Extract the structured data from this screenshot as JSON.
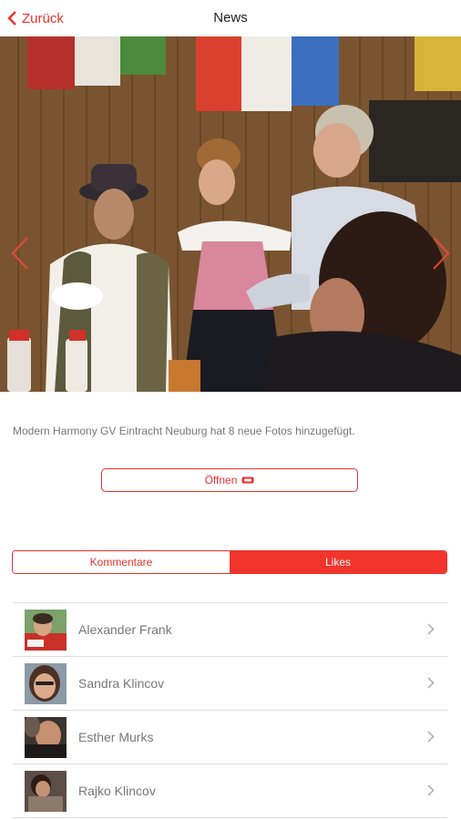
{
  "nav": {
    "back_label": "Zurück",
    "title": "News"
  },
  "post": {
    "caption": "Modern Harmony GV Eintracht Neuburg hat 8 neue Fotos hinzugefügt.",
    "open_label": "Öffnen"
  },
  "tabs": [
    {
      "label": "Kommentare",
      "active": false
    },
    {
      "label": "Likes",
      "active": true
    }
  ],
  "likes": [
    {
      "name": "Alexander Frank"
    },
    {
      "name": "Sandra Klincov"
    },
    {
      "name": "Esther Murks"
    },
    {
      "name": "Rajko Klincov"
    }
  ],
  "colors": {
    "accent": "#e8322e",
    "tab_active_bg": "#f2352c",
    "text_muted": "#777777",
    "divider": "#dddddd"
  },
  "icons": {
    "back": "chevron-left-icon",
    "open": "external-link-icon",
    "prev": "chevron-left-icon",
    "next": "chevron-right-icon",
    "row": "chevron-right-icon"
  }
}
